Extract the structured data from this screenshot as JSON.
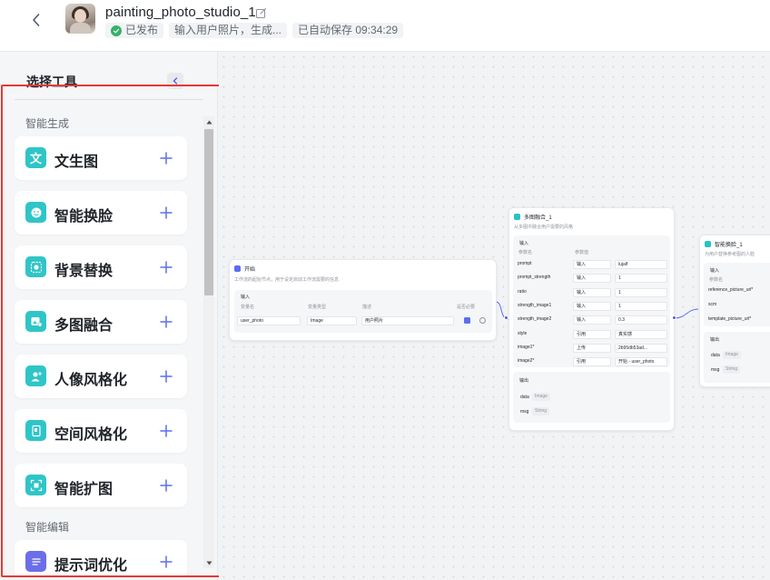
{
  "header": {
    "title": "painting_photo_studio_1",
    "status_published": "已发布",
    "description_preview": "输入用户照片，生成...",
    "autosave": "已自动保存 09:34:29"
  },
  "tool_panel": {
    "title": "选择工具",
    "sections": [
      {
        "label": "智能生成",
        "tools": [
          {
            "label": "文生图",
            "icon": "text-to-image-icon"
          },
          {
            "label": "智能换脸",
            "icon": "face-swap-icon"
          },
          {
            "label": "背景替换",
            "icon": "background-replace-icon"
          },
          {
            "label": "多图融合",
            "icon": "image-fusion-icon"
          },
          {
            "label": "人像风格化",
            "icon": "portrait-stylize-icon"
          },
          {
            "label": "空间风格化",
            "icon": "space-stylize-icon"
          },
          {
            "label": "智能扩图",
            "icon": "image-expand-icon"
          }
        ]
      },
      {
        "label": "智能编辑",
        "tools": [
          {
            "label": "提示词优化",
            "icon": "prompt-optimize-icon"
          }
        ]
      }
    ],
    "text_icon_glyph": "文"
  },
  "canvas": {
    "start_node": {
      "title": "开始",
      "desc": "工作流的起始节点，用于设定启动工作流需要的信息",
      "section": "输入",
      "col_name": "变量名",
      "col_type": "变量类型",
      "col_desc": "描述",
      "col_required": "是否必要",
      "var_name": "user_photo",
      "var_type": "Image",
      "var_desc": "用户照片"
    },
    "fusion_node": {
      "title": "多图融合_1",
      "desc": "从多图中融合用户需要的风格",
      "input_section": "输入",
      "col_param": "参数名",
      "col_value": "参数值",
      "params": [
        {
          "name": "prompt",
          "mode": "输入",
          "value": "lujalf"
        },
        {
          "name": "prompt_strength",
          "mode": "输入",
          "value": "1"
        },
        {
          "name": "ratio",
          "mode": "输入",
          "value": "1"
        },
        {
          "name": "strength_image1",
          "mode": "输入",
          "value": "1"
        },
        {
          "name": "strength_image2",
          "mode": "输入",
          "value": "0.3"
        },
        {
          "name": "style",
          "mode": "引用",
          "value": "真实感"
        },
        {
          "name": "image1*",
          "mode": "上传",
          "value": "2b95db53ad..."
        },
        {
          "name": "image2*",
          "mode": "引用",
          "value": "开始 - user_photo"
        }
      ],
      "output_section": "输出",
      "outputs": [
        {
          "name": "data",
          "type": "Image"
        },
        {
          "name": "msg",
          "type": "String"
        }
      ]
    },
    "faceswap_node": {
      "title": "智能换脸_1",
      "desc": "为用户替换参考图的人脸",
      "input_section": "输入",
      "col_param": "参数名",
      "params": [
        "reference_picture_url*",
        "scm",
        "template_picture_url*"
      ],
      "output_section": "输出",
      "outputs": [
        {
          "name": "data",
          "type": "Image"
        },
        {
          "name": "msg",
          "type": "String"
        }
      ]
    }
  },
  "colors": {
    "accent": "#5b6ef0",
    "tool_icon": "#2fc5c7",
    "highlight_outline": "#e53935",
    "published": "#34b16a"
  }
}
